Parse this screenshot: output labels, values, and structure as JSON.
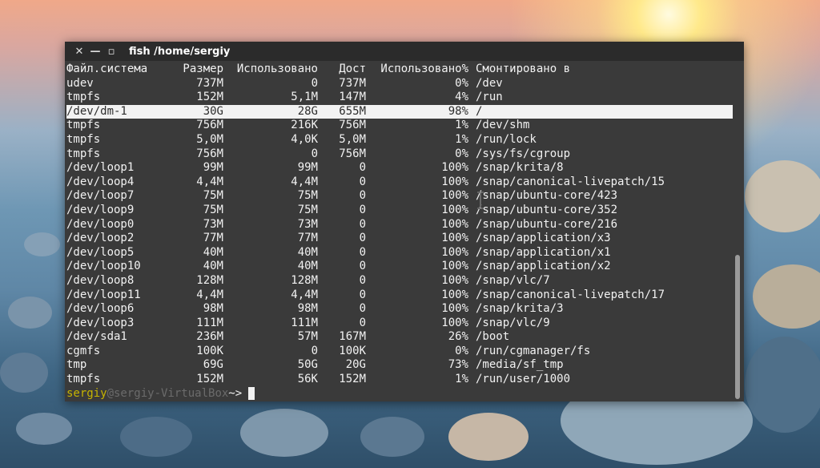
{
  "window": {
    "title": "fish  /home/sergiy",
    "close_icon": "close-icon",
    "minimize_icon": "minimize-icon",
    "maximize_icon": "maximize-icon"
  },
  "header": [
    "Файл.система",
    "Размер",
    "Использовано",
    "Дост",
    "Использовано%",
    "Смонтировано в"
  ],
  "rows": [
    [
      "udev",
      "737M",
      "0",
      "737M",
      "0%",
      "/dev"
    ],
    [
      "tmpfs",
      "152M",
      "5,1M",
      "147M",
      "4%",
      "/run"
    ],
    [
      "/dev/dm-1",
      "30G",
      "28G",
      "655M",
      "98%",
      "/"
    ],
    [
      "tmpfs",
      "756M",
      "216K",
      "756M",
      "1%",
      "/dev/shm"
    ],
    [
      "tmpfs",
      "5,0M",
      "4,0K",
      "5,0M",
      "1%",
      "/run/lock"
    ],
    [
      "tmpfs",
      "756M",
      "0",
      "756M",
      "0%",
      "/sys/fs/cgroup"
    ],
    [
      "/dev/loop1",
      "99M",
      "99M",
      "0",
      "100%",
      "/snap/krita/8"
    ],
    [
      "/dev/loop4",
      "4,4M",
      "4,4M",
      "0",
      "100%",
      "/snap/canonical-livepatch/15"
    ],
    [
      "/dev/loop7",
      "75M",
      "75M",
      "0",
      "100%",
      "/snap/ubuntu-core/423"
    ],
    [
      "/dev/loop9",
      "75M",
      "75M",
      "0",
      "100%",
      "/snap/ubuntu-core/352"
    ],
    [
      "/dev/loop0",
      "73M",
      "73M",
      "0",
      "100%",
      "/snap/ubuntu-core/216"
    ],
    [
      "/dev/loop2",
      "77M",
      "77M",
      "0",
      "100%",
      "/snap/application/x3"
    ],
    [
      "/dev/loop5",
      "40M",
      "40M",
      "0",
      "100%",
      "/snap/application/x1"
    ],
    [
      "/dev/loop10",
      "40M",
      "40M",
      "0",
      "100%",
      "/snap/application/x2"
    ],
    [
      "/dev/loop8",
      "128M",
      "128M",
      "0",
      "100%",
      "/snap/vlc/7"
    ],
    [
      "/dev/loop11",
      "4,4M",
      "4,4M",
      "0",
      "100%",
      "/snap/canonical-livepatch/17"
    ],
    [
      "/dev/loop6",
      "98M",
      "98M",
      "0",
      "100%",
      "/snap/krita/3"
    ],
    [
      "/dev/loop3",
      "111M",
      "111M",
      "0",
      "100%",
      "/snap/vlc/9"
    ],
    [
      "/dev/sda1",
      "236M",
      "57M",
      "167M",
      "26%",
      "/boot"
    ],
    [
      "cgmfs",
      "100K",
      "0",
      "100K",
      "0%",
      "/run/cgmanager/fs"
    ],
    [
      "tmp",
      "69G",
      "50G",
      "20G",
      "73%",
      "/media/sf_tmp"
    ],
    [
      "tmpfs",
      "152M",
      "56K",
      "152M",
      "1%",
      "/run/user/1000"
    ]
  ],
  "highlighted_row_index": 2,
  "prompt": {
    "user": "sergiy",
    "host": "@sergiy-VirtualBox",
    "separator": "~>"
  },
  "colors": {
    "terminal_bg": "#3a3a3a",
    "highlight_bg": "#f2f2f2",
    "prompt_user": "#c7b400",
    "prompt_host": "#6b6b6b"
  }
}
